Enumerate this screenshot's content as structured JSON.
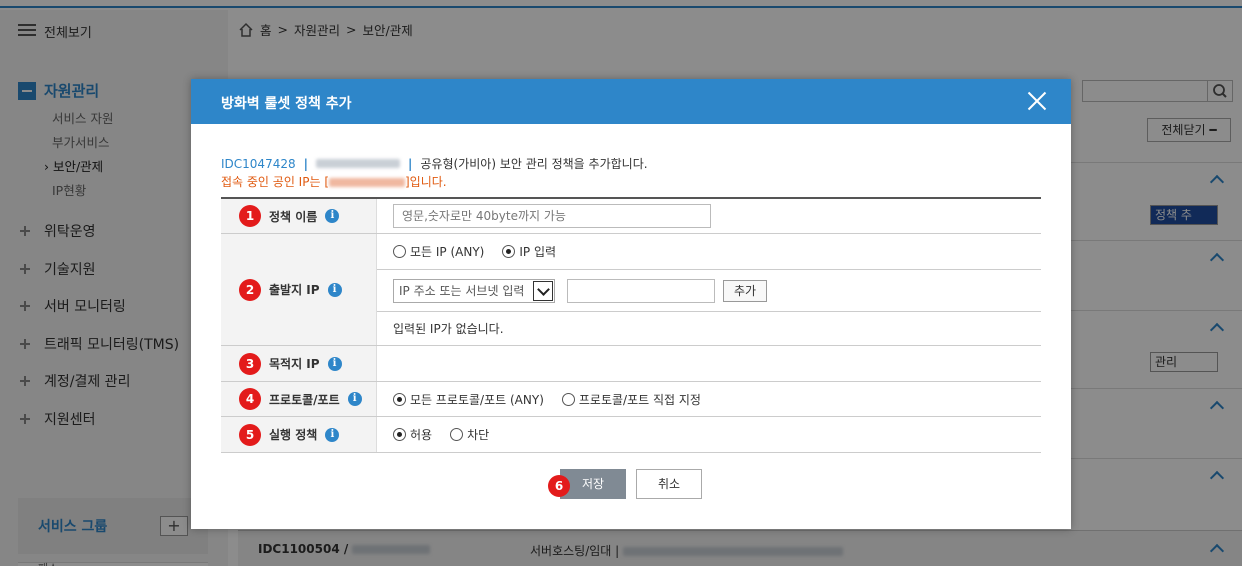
{
  "app": {
    "all_view": "전체보기",
    "breadcrumb": [
      "홈",
      ">",
      "자원관리",
      ">",
      "보안/관제"
    ]
  },
  "sidebar": {
    "main_category": "자원관리",
    "sub_items": [
      "서비스 자원",
      "부가서비스",
      "› 보안/관제",
      "IP현황"
    ],
    "categories": [
      "위탁운영",
      "기술지원",
      "서버 모니터링",
      "트래픽 모니터링(TMS)",
      "계정/결제 관리",
      "지원센터"
    ],
    "service_group": "서비스 그룹",
    "service_group_add": "+",
    "bottom_item": "패스"
  },
  "background": {
    "close_all": "전체닫기 ━",
    "policy_select": "정책 추",
    "manage_select": "관리",
    "row_idc": "IDC1100504 /",
    "row_host": "서버호스팅/임대 |"
  },
  "modal": {
    "title": "방화벽 룰셋 정책 추가",
    "idc": "IDC1047428",
    "sep": "|",
    "desc": "공유형(가비아) 보안 관리 정책을 추가합니다.",
    "public_ip_prefix": "접속 중인 공인 IP는 [",
    "public_ip_suffix": "]입니다.",
    "rows": {
      "policy_name": {
        "num": "1",
        "label": "정책 이름",
        "placeholder": "영문,숫자로만 40byte까지 가능"
      },
      "source_ip": {
        "num": "2",
        "label": "출발지 IP",
        "radio_any": "모든 IP (ANY)",
        "radio_input": "IP 입력",
        "select_value": "IP 주소 또는 서브넷 입력",
        "add_button": "추가",
        "empty_msg": "입력된 IP가 없습니다."
      },
      "dest_ip": {
        "num": "3",
        "label": "목적지 IP"
      },
      "protocol": {
        "num": "4",
        "label": "프로토콜/포트",
        "radio_any": "모든 프로토콜/포트 (ANY)",
        "radio_custom": "프로토콜/포트 직접 지정"
      },
      "action": {
        "num": "5",
        "label": "실행 정책",
        "radio_allow": "허용",
        "radio_deny": "차단"
      }
    },
    "save_num": "6",
    "save": "저장",
    "cancel": "취소"
  },
  "colors": {
    "accent": "#2e86c9",
    "badge": "#e31b1b",
    "warning": "#e05a10"
  },
  "icons": [
    "menu-icon",
    "home-icon",
    "close-icon",
    "info-icon",
    "search-icon",
    "chevron-up-icon"
  ]
}
